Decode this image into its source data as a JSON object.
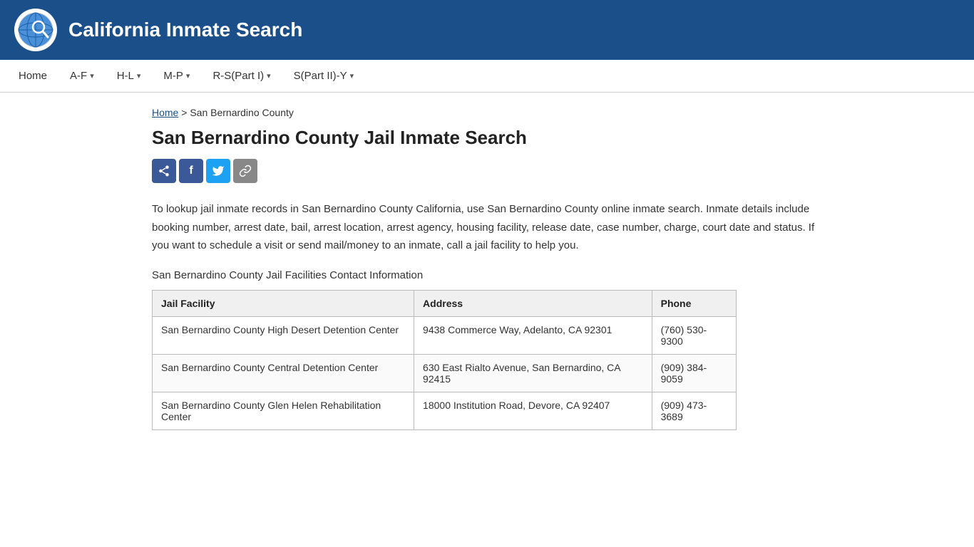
{
  "header": {
    "title": "California Inmate Search",
    "logo_alt": "California globe logo"
  },
  "nav": {
    "items": [
      {
        "label": "Home",
        "has_dropdown": false
      },
      {
        "label": "A-F",
        "has_dropdown": true
      },
      {
        "label": "H-L",
        "has_dropdown": true
      },
      {
        "label": "M-P",
        "has_dropdown": true
      },
      {
        "label": "R-S(Part I)",
        "has_dropdown": true
      },
      {
        "label": "S(Part II)-Y",
        "has_dropdown": true
      }
    ]
  },
  "breadcrumb": {
    "home_label": "Home",
    "separator": ">",
    "current": "San Bernardino County"
  },
  "page_title": "San Bernardino County Jail Inmate Search",
  "social_buttons": [
    {
      "label": "Share",
      "type": "share"
    },
    {
      "label": "f",
      "type": "facebook"
    },
    {
      "label": "🐦",
      "type": "twitter"
    },
    {
      "label": "🔗",
      "type": "copy"
    }
  ],
  "description": "To lookup jail inmate records in San Bernardino County California, use San Bernardino County online inmate search. Inmate details include booking number, arrest date, bail, arrest location, arrest agency, housing facility, release date, case number, charge, court date and status. If you want to schedule a visit or send mail/money to an inmate, call a jail facility to help you.",
  "facilities_section_title": "San Bernardino County Jail Facilities Contact Information",
  "table": {
    "columns": [
      "Jail Facility",
      "Address",
      "Phone"
    ],
    "rows": [
      {
        "facility": "San Bernardino County High Desert Detention Center",
        "address": "9438 Commerce Way, Adelanto, CA 92301",
        "phone": "(760) 530-9300"
      },
      {
        "facility": "San Bernardino County Central Detention Center",
        "address": "630 East Rialto Avenue, San Bernardino, CA 92415",
        "phone": "(909) 384-9059"
      },
      {
        "facility": "San Bernardino County Glen Helen Rehabilitation Center",
        "address": "18000 Institution Road, Devore, CA 92407",
        "phone": "(909) 473-3689"
      }
    ]
  },
  "colors": {
    "header_bg": "#1a4f8a",
    "header_text": "#ffffff",
    "nav_bg": "#ffffff",
    "accent": "#1a4f8a"
  }
}
